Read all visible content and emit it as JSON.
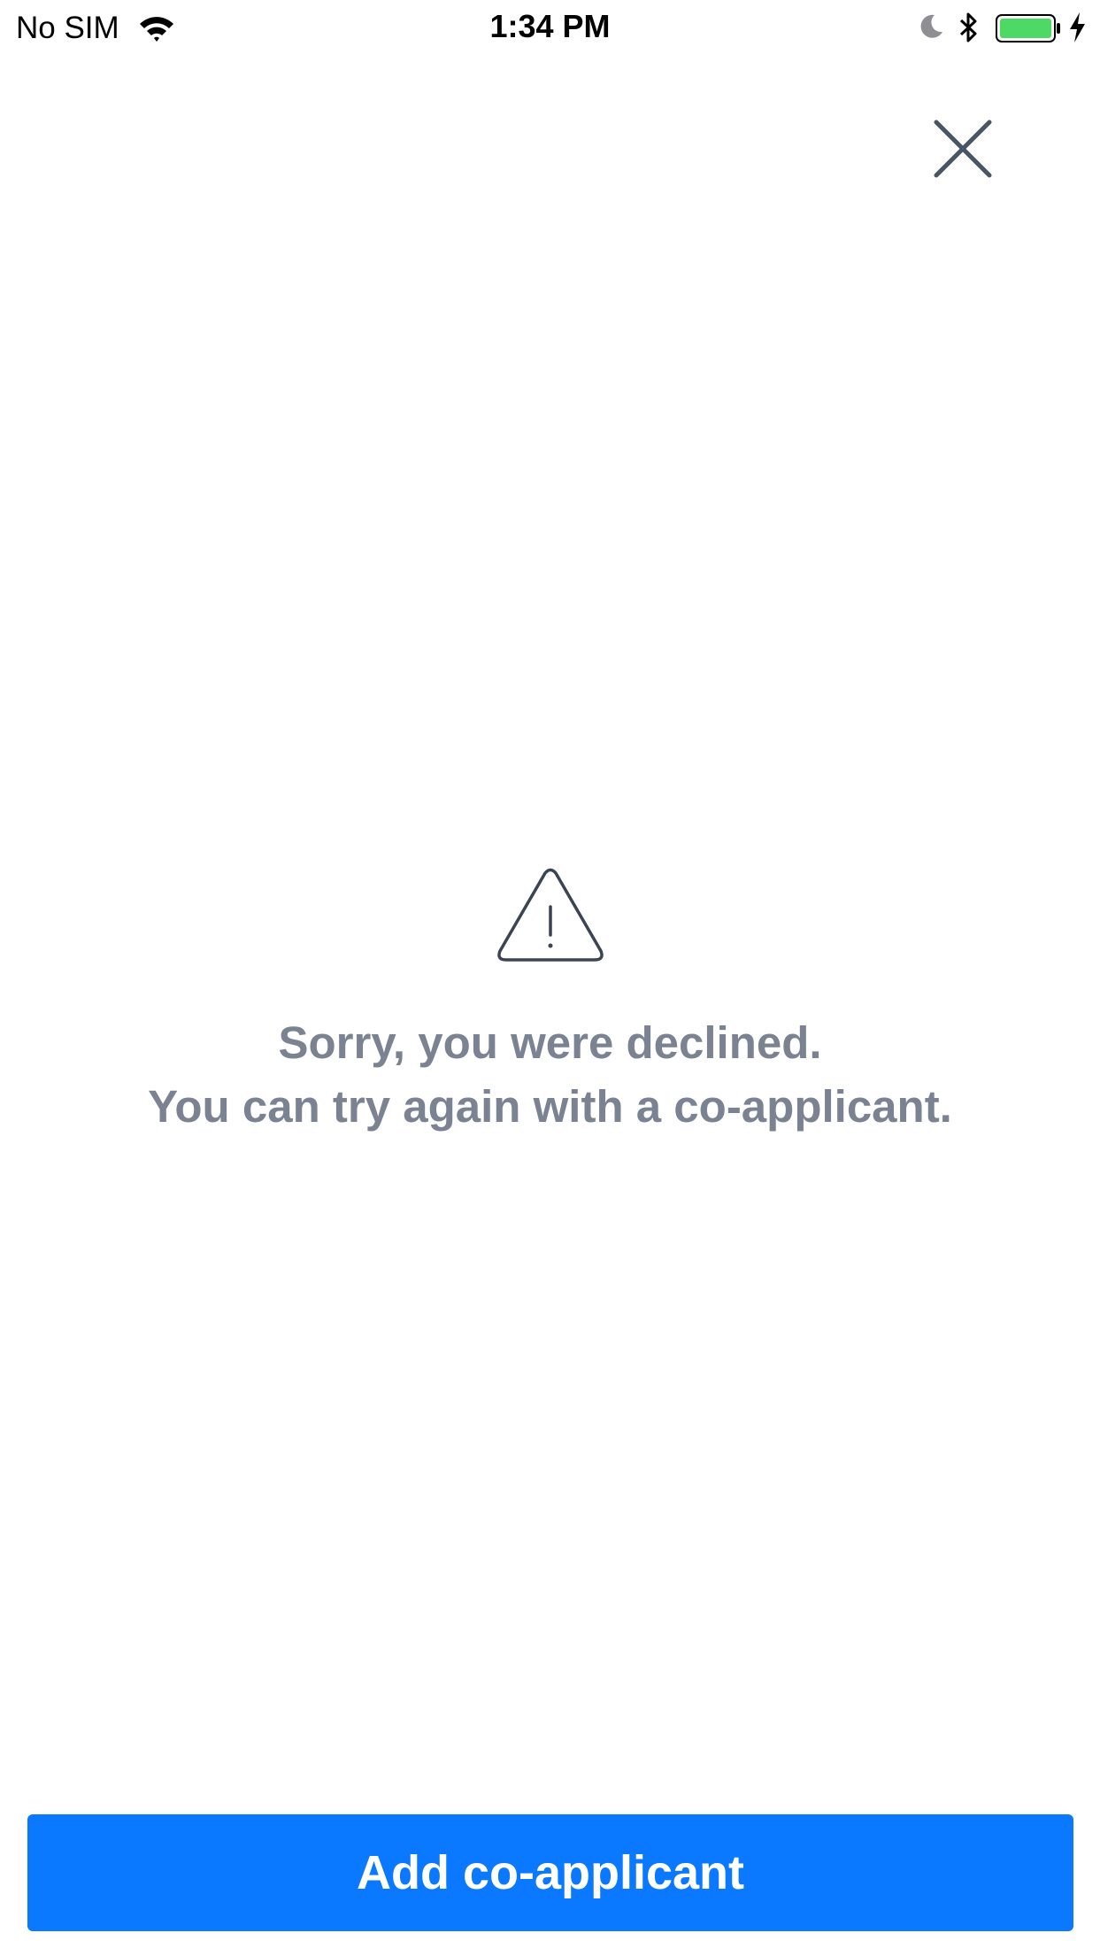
{
  "status_bar": {
    "carrier": "No SIM",
    "time": "1:34 PM",
    "battery_color": "#4cd964",
    "icons": [
      "wifi-icon",
      "moon-icon",
      "bluetooth-icon",
      "battery-icon",
      "charging-bolt-icon"
    ]
  },
  "close": {
    "icon": "close-icon"
  },
  "message": {
    "icon": "warning-icon",
    "line1": "Sorry, you were declined.",
    "line2": "You can try again with a co-applicant.",
    "color": "#7b8392"
  },
  "cta": {
    "label": "Add co-applicant",
    "color": "#0a79ff"
  }
}
